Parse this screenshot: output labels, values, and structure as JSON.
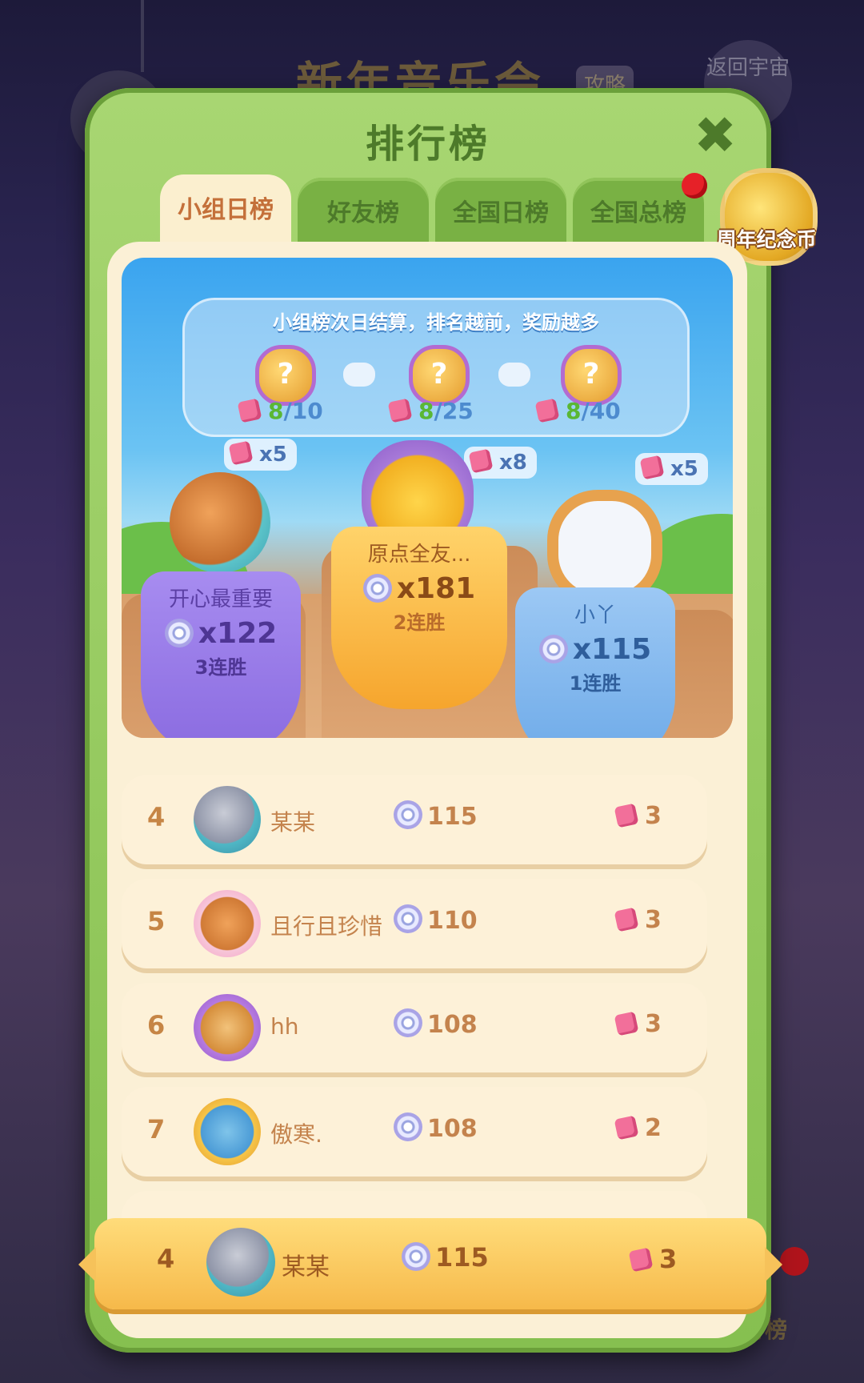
{
  "background": {
    "title": "新年音乐会",
    "tag": "攻略",
    "back_button": "返回宇宙",
    "side_label": "排行榜"
  },
  "panel": {
    "title": "排行榜",
    "close_icon": "close-icon"
  },
  "tabs": [
    {
      "label": "小组日榜",
      "active": true
    },
    {
      "label": "好友榜",
      "active": false
    },
    {
      "label": "全国日榜",
      "active": false
    },
    {
      "label": "全国总榜",
      "active": false
    }
  ],
  "anniversary": {
    "label": "周年纪念币"
  },
  "info": {
    "text": "小组榜次日结算，排名越前，奖励越多",
    "rewards": [
      {
        "icon": "?",
        "current": "8",
        "total": "/10"
      },
      {
        "icon": "?",
        "current": "8",
        "total": "/25"
      },
      {
        "icon": "?",
        "current": "8",
        "total": "/40"
      }
    ]
  },
  "podium": [
    {
      "place": 2,
      "name": "开心最重要",
      "score": "x122",
      "streak": "3连胜",
      "reward": "x5"
    },
    {
      "place": 1,
      "name": "原点全友...",
      "score": "x181",
      "streak": "2连胜",
      "reward": "x8"
    },
    {
      "place": 3,
      "name": "小丫",
      "score": "x115",
      "streak": "1连胜",
      "reward": "x5"
    }
  ],
  "ranking": [
    {
      "rank": "4",
      "name": "某某",
      "score": "115",
      "tickets": "3"
    },
    {
      "rank": "5",
      "name": "且行且珍惜",
      "score": "110",
      "tickets": "3"
    },
    {
      "rank": "6",
      "name": "hh",
      "score": "108",
      "tickets": "3"
    },
    {
      "rank": "7",
      "name": "傲寒.",
      "score": "108",
      "tickets": "2"
    }
  ],
  "mine": {
    "rank": "4",
    "name": "某某",
    "score": "115",
    "tickets": "3"
  },
  "colors": {
    "panel": "#86c050",
    "active_tab": "#fbefcf",
    "gold": "#f6b94a",
    "purple": "#9b7ee8",
    "blue": "#6ca9e8"
  }
}
